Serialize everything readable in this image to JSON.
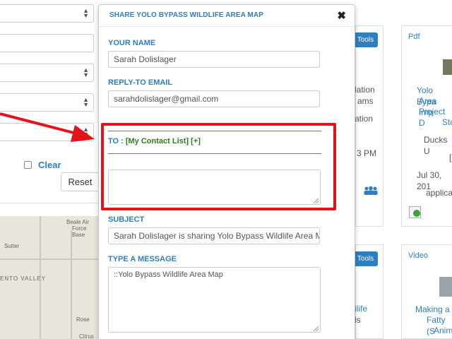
{
  "filters": {
    "clear_label": "Clear",
    "reset_label": "Reset"
  },
  "map": {
    "labels": [
      "Beale Air",
      "Force",
      "Base",
      "Sutter",
      "ENTO VALLEY",
      "Rose",
      "Citrus"
    ]
  },
  "modal": {
    "title": "SHARE YOLO BYPASS WILDLIFE AREA MAP",
    "close_glyph": "✖",
    "name_label": "YOUR NAME",
    "name_value": "Sarah Dolislager",
    "reply_label": "REPLY-TO EMAIL",
    "reply_value": "sarahdolislager@gmail.com",
    "to_label": "TO :",
    "contact_list_label": "[My Contact List]",
    "add_label": "[+]",
    "to_value": "",
    "subject_label": "SUBJECT",
    "subject_value": "Sarah Dolislager is sharing Yolo Bypass Wildlife Area Map",
    "message_label": "TYPE A MESSAGE",
    "message_value": "::Yolo Bypass Wildlife Area Map"
  },
  "cards": {
    "tools_label": "Tools",
    "middle_top_lines": [
      "lation",
      "ams",
      "ation",
      "3 PM"
    ],
    "middle_bottom_lines": [
      "ilife",
      "ls"
    ],
    "right_top": {
      "tag": "Pdf",
      "title_lines": [
        "Yolo Bypa",
        "Area Imp",
        "Project D",
        "Sto"
      ],
      "meta_lines": [
        "Ducks U",
        "[",
        "Jul 30, 201",
        "applica"
      ]
    },
    "right_bottom": {
      "tag": "Video",
      "title_lines": [
        "Making a",
        "Fatty (S",
        "Anim"
      ]
    }
  },
  "colors": {
    "accent": "#2d7fc1",
    "annotation_red": "#e3121b",
    "contact_green": "#2e7d1e"
  }
}
